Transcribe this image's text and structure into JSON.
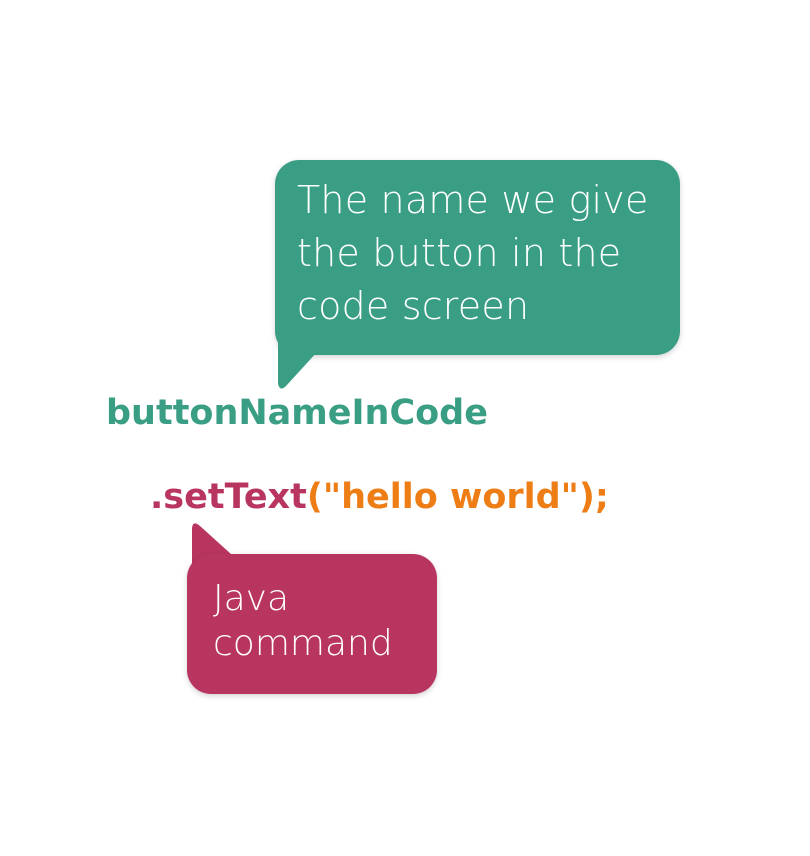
{
  "colors": {
    "green": "#3a9e84",
    "pink": "#b8355f",
    "orange": "#ee7d16"
  },
  "bubbles": {
    "name": {
      "text": "The name we give\nthe button in the\ncode screen"
    },
    "command": {
      "text": "Java\ncommand"
    }
  },
  "code": {
    "object_name": "buttonNameInCode",
    "method": ".setText",
    "arguments": "(\"hello world\");"
  }
}
